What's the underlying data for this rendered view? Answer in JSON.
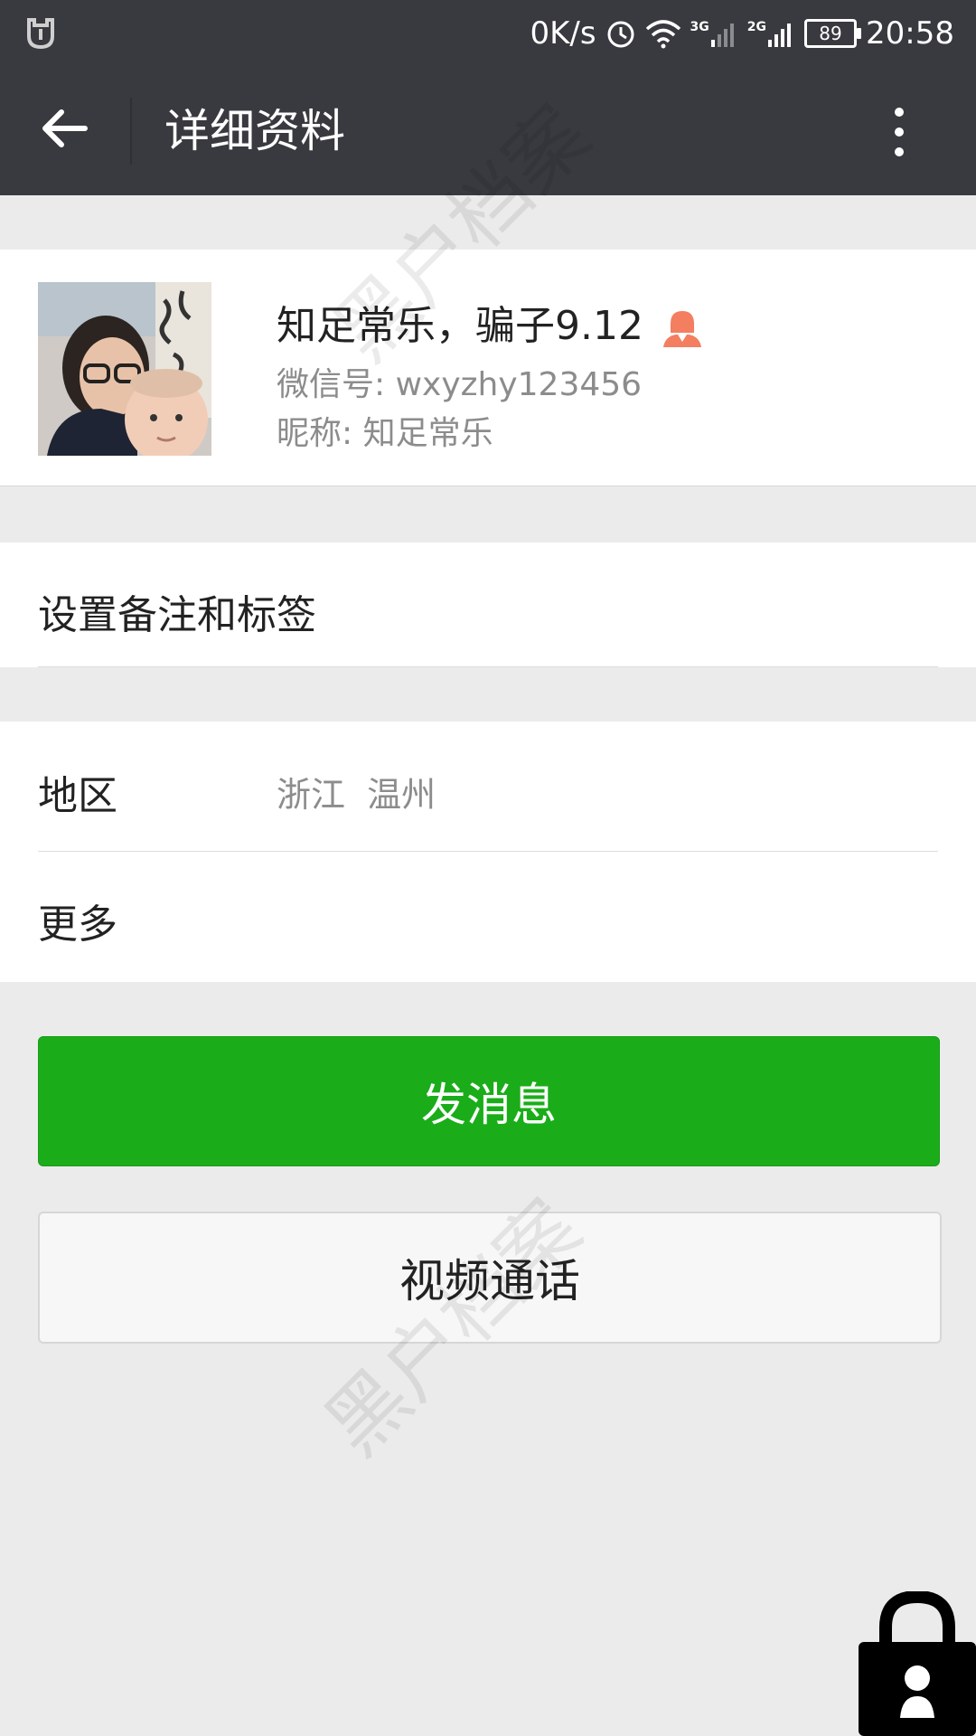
{
  "status_bar": {
    "speed": "0K/s",
    "network1": "3G",
    "network2": "2G",
    "battery": "89",
    "time": "20:58",
    "icons": [
      "notification-icon",
      "alarm-icon",
      "wifi-icon",
      "signal-3g-icon",
      "signal-2g-icon",
      "battery-icon"
    ]
  },
  "header": {
    "title": "详细资料",
    "back_icon": "back-arrow-icon",
    "menu_icon": "more-vertical-icon"
  },
  "profile": {
    "display_name": "知足常乐，骗子9.12",
    "gender_icon": "female-icon",
    "wechat_id": "微信号: wxyzhy123456",
    "nickname": "昵称: 知足常乐"
  },
  "section_note": {
    "label": "设置备注和标签"
  },
  "section_info": {
    "region_label": "地区",
    "region_value": "浙江  温州",
    "more_label": "更多"
  },
  "buttons": {
    "send_message": "发消息",
    "video_call": "视频通话"
  },
  "watermark": "黑户档案",
  "colors": {
    "header_bg": "#393a3f",
    "primary_green": "#1aad19",
    "background": "#ebebeb",
    "female_icon": "#f37e60"
  }
}
